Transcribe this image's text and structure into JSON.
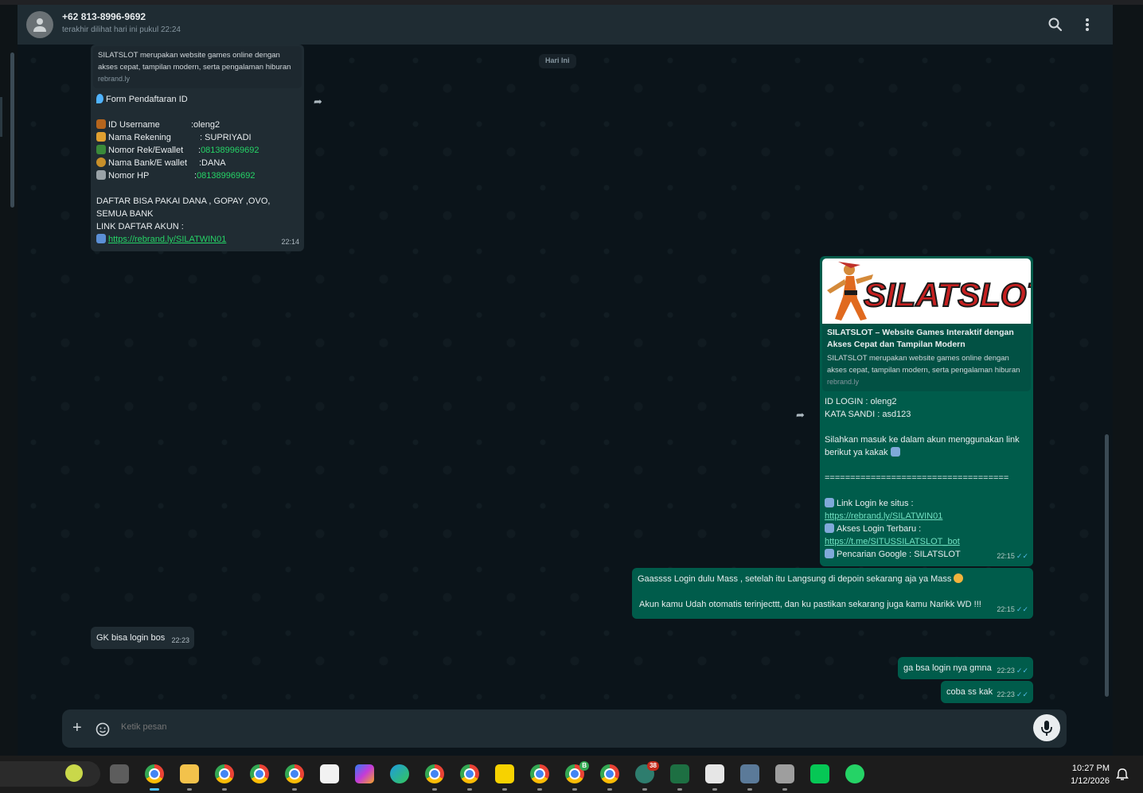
{
  "header": {
    "contact": "+62 813-8996-9692",
    "status": "terakhir dilihat hari ini pukul 22:24",
    "search_icon": "search-icon",
    "menu_icon": "more-vertical-icon"
  },
  "date_chip": "Hari Ini",
  "messages": {
    "m1": {
      "preview_desc": "SILATSLOT merupakan website games online dengan akses cepat, tampilan modern, serta pengalaman hiburan",
      "preview_domain": "rebrand.ly",
      "title": "Form Pendaftaran ID",
      "f1_label": "ID Username",
      "f1_value": ":oleng2",
      "f2_label": "Nama Rekening",
      "f2_value": ": SUPRIYADI",
      "f3_label": "Nomor Rek/Ewallet",
      "f3_sep": ":",
      "f3_value": "081389969692",
      "f4_label": "Nama Bank/E wallet",
      "f4_value": ":DANA",
      "f5_label": "Nomor HP",
      "f5_sep": ":",
      "f5_value": "081389969692",
      "line1": "DAFTAR BISA PAKAI DANA , GOPAY ,OVO, SEMUA BANK",
      "line2": "LINK DAFTAR AKUN :",
      "link": "https://rebrand.ly/SILATWIN01",
      "time": "22:14"
    },
    "m2": {
      "logo_text": "SILATSLOT",
      "preview_title": "SILATSLOT – Website Games Interaktif dengan Akses Cepat dan Tampilan Modern",
      "preview_desc": "SILATSLOT merupakan website games online dengan akses cepat, tampilan modern, serta pengalaman hiburan",
      "preview_domain": "rebrand.ly",
      "id_login": "ID LOGIN : oleng2",
      "password": "KATA SANDI : asd123",
      "prompt": "Silahkan masuk ke dalam akun menggunakan link berikut ya kakak",
      "divider": "====================================",
      "l1_label": "Link Login ke situs  :",
      "l1_url": "https://rebrand.ly/SILATWIN01",
      "l2_label": "Akses Login Terbaru :",
      "l2_url": "https://t.me/SITUSSILATSLOT_bot",
      "l3_label": "Pencarian Google : SILATSLOT",
      "time": "22:15"
    },
    "m3": {
      "line1": "Gaassss Login dulu Mass  , setelah itu Langsung di depoin sekarang aja ya Mass",
      "line2": "Akun kamu Udah otomatis terinjecttt, dan ku pastikan sekarang juga kamu Narikk WD !!!",
      "time": "22:15"
    },
    "m4": {
      "text": "GK bisa login bos",
      "time": "22:23"
    },
    "m5": {
      "text": "ga bsa login nya gmna",
      "time": "22:23"
    },
    "m6": {
      "text": "coba ss kak",
      "time": "22:23"
    }
  },
  "composer": {
    "placeholder": "Ketik pesan"
  },
  "taskbar": {
    "badge_count": "38",
    "badge_b": "B",
    "time": "10:27 PM",
    "date": "1/12/2026"
  }
}
